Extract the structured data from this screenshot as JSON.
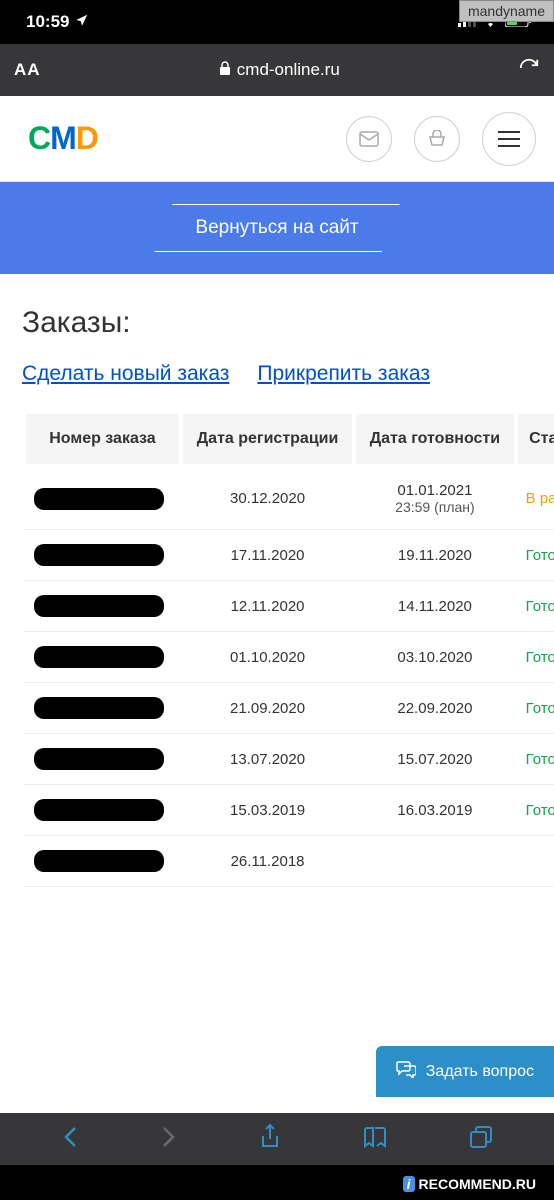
{
  "watermark": {
    "top": "mandyname",
    "bottom": "RECOMMEND.RU"
  },
  "status": {
    "time": "10:59"
  },
  "url": {
    "aa": "AA",
    "domain": "cmd-online.ru"
  },
  "logo": {
    "c": "C",
    "m": "M",
    "d": "D"
  },
  "banner": {
    "return": "Вернуться на сайт"
  },
  "page": {
    "title": "Заказы:"
  },
  "actions": {
    "new": "Сделать новый заказ",
    "attach": "Прикрепить заказ"
  },
  "table": {
    "headers": {
      "order": "Номер заказа",
      "reg": "Дата регистрации",
      "ready": "Дата готовности",
      "status": "Стат"
    },
    "rows": [
      {
        "reg": "30.12.2020",
        "ready": "01.01.2021",
        "ready_sub": "23:59 (план)",
        "status": "В раб",
        "statusClass": "status-progress"
      },
      {
        "reg": "17.11.2020",
        "ready": "19.11.2020",
        "status": "Гото",
        "statusClass": "status-ready"
      },
      {
        "reg": "12.11.2020",
        "ready": "14.11.2020",
        "status": "Гото",
        "statusClass": "status-ready"
      },
      {
        "reg": "01.10.2020",
        "ready": "03.10.2020",
        "status": "Гото",
        "statusClass": "status-ready"
      },
      {
        "reg": "21.09.2020",
        "ready": "22.09.2020",
        "status": "Гото",
        "statusClass": "status-ready"
      },
      {
        "reg": "13.07.2020",
        "ready": "15.07.2020",
        "status": "Гото",
        "statusClass": "status-ready"
      },
      {
        "reg": "15.03.2019",
        "ready": "16.03.2019",
        "status": "Гото",
        "statusClass": "status-ready"
      },
      {
        "reg": "26.11.2018",
        "ready": "",
        "status": "",
        "statusClass": ""
      }
    ]
  },
  "chat": {
    "label": "Задать вопрос"
  }
}
